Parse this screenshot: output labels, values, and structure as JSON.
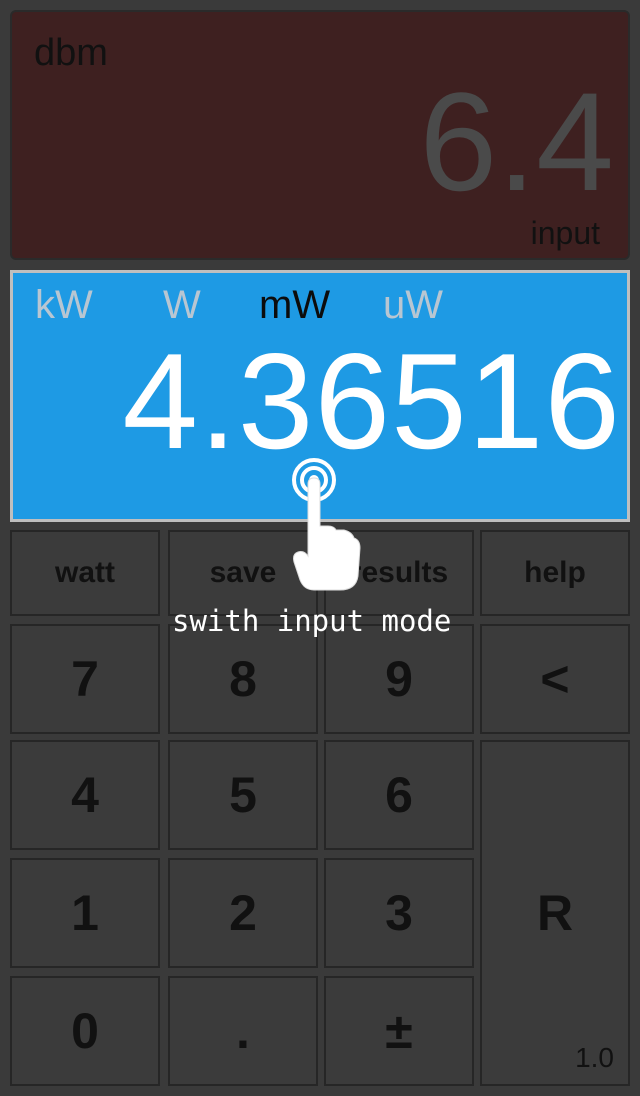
{
  "input_panel": {
    "unit": "dbm",
    "value": "6.4",
    "caption": "input"
  },
  "output_panel": {
    "units": [
      "kW",
      "W",
      "mW",
      "uW"
    ],
    "selected_unit": "mW",
    "value": "4.36516"
  },
  "keys": {
    "watt": "watt",
    "save": "save",
    "results": "results",
    "help": "help",
    "seven": "7",
    "eight": "8",
    "nine": "9",
    "back": "<",
    "four": "4",
    "five": "5",
    "six": "6",
    "one": "1",
    "two": "2",
    "three": "3",
    "reset": "R",
    "zero": "0",
    "dot": ".",
    "plusminus": "±"
  },
  "version": "1.0",
  "hint": "swith input mode",
  "icons": {
    "tap": "tap-gesture-icon"
  },
  "colors": {
    "output_bg": "#1e9ae4",
    "input_bg": "#3e2020"
  }
}
